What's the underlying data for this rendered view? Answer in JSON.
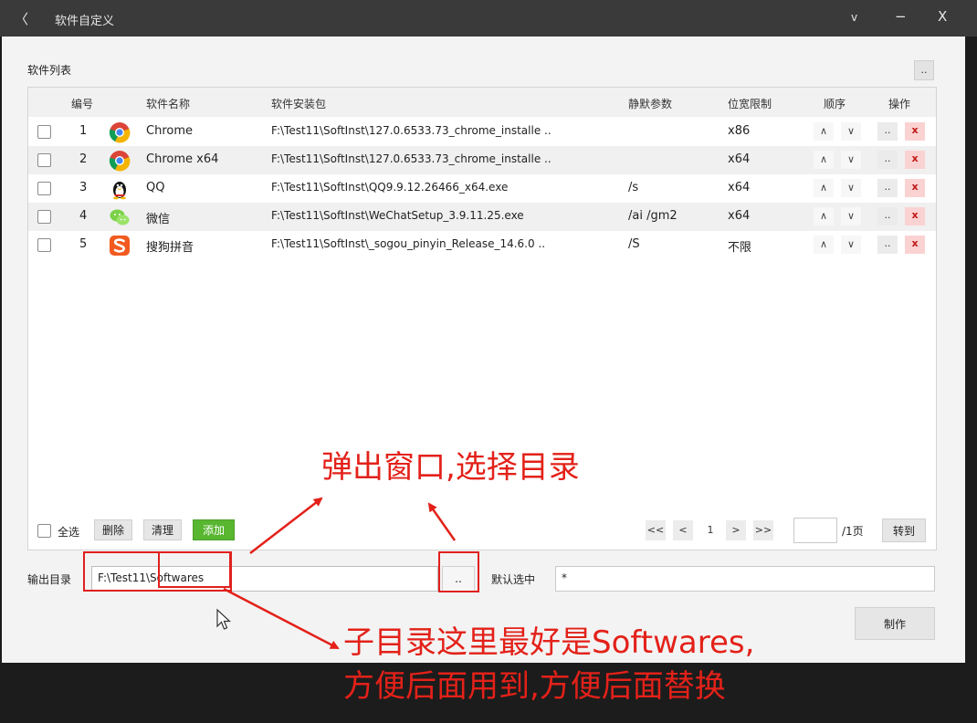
{
  "window": {
    "back_glyph": "〈",
    "title": "软件自定义",
    "controls": {
      "dropdown": "v",
      "minimize": "−",
      "close": "X"
    }
  },
  "list": {
    "title": "软件列表",
    "more_label": "..",
    "headers": {
      "num": "编号",
      "name": "软件名称",
      "package": "软件安装包",
      "silent": "静默参数",
      "arch": "位宽限制",
      "order": "顺序",
      "ops": "操作"
    },
    "rows": [
      {
        "num": "1",
        "icon": "chrome-icon",
        "name": "Chrome",
        "package": "F:\\Test11\\SoftInst\\127.0.6533.73_chrome_installe ..",
        "silent": "",
        "arch": "x86"
      },
      {
        "num": "2",
        "icon": "chrome-icon",
        "name": "Chrome x64",
        "package": "F:\\Test11\\SoftInst\\127.0.6533.73_chrome_installe ..",
        "silent": "",
        "arch": "x64"
      },
      {
        "num": "3",
        "icon": "qq-penguin-icon",
        "name": "QQ",
        "package": "F:\\Test11\\SoftInst\\QQ9.9.12.26466_x64.exe",
        "silent": "/s",
        "arch": "x64"
      },
      {
        "num": "4",
        "icon": "wechat-icon",
        "name": "微信",
        "package": "F:\\Test11\\SoftInst\\WeChatSetup_3.9.11.25.exe",
        "silent": "/ai /gm2",
        "arch": "x64"
      },
      {
        "num": "5",
        "icon": "sogou-icon",
        "name": "搜狗拼音",
        "package": "F:\\Test11\\SoftInst\\_sogou_pinyin_Release_14.6.0 ..",
        "silent": "/S",
        "arch": "不限"
      }
    ],
    "order_up": "∧",
    "order_down": "∨",
    "op_more": "..",
    "op_delete": "x"
  },
  "footer": {
    "select_all": "全选",
    "delete": "删除",
    "clear": "清理",
    "add": "添加",
    "pager": {
      "first": "<<",
      "prev": "<",
      "page": "1",
      "next": ">",
      "last": ">>",
      "page_input": "",
      "total": "/1页",
      "goto": "转到"
    }
  },
  "output": {
    "label": "输出目录",
    "value": "F:\\Test11\\Softwares",
    "browse": "..",
    "default_label": "默认选中",
    "default_value": "*",
    "make": "制作"
  },
  "annotations": {
    "popup": "弹出窗口,选择目录",
    "subdir_line1": "子目录这里最好是Softwares,",
    "subdir_line2": "方便后面用到,方便后面替换"
  },
  "colors": {
    "annotation_red": "#e32119",
    "add_green": "#58b630",
    "delete_red": "#c01818"
  }
}
